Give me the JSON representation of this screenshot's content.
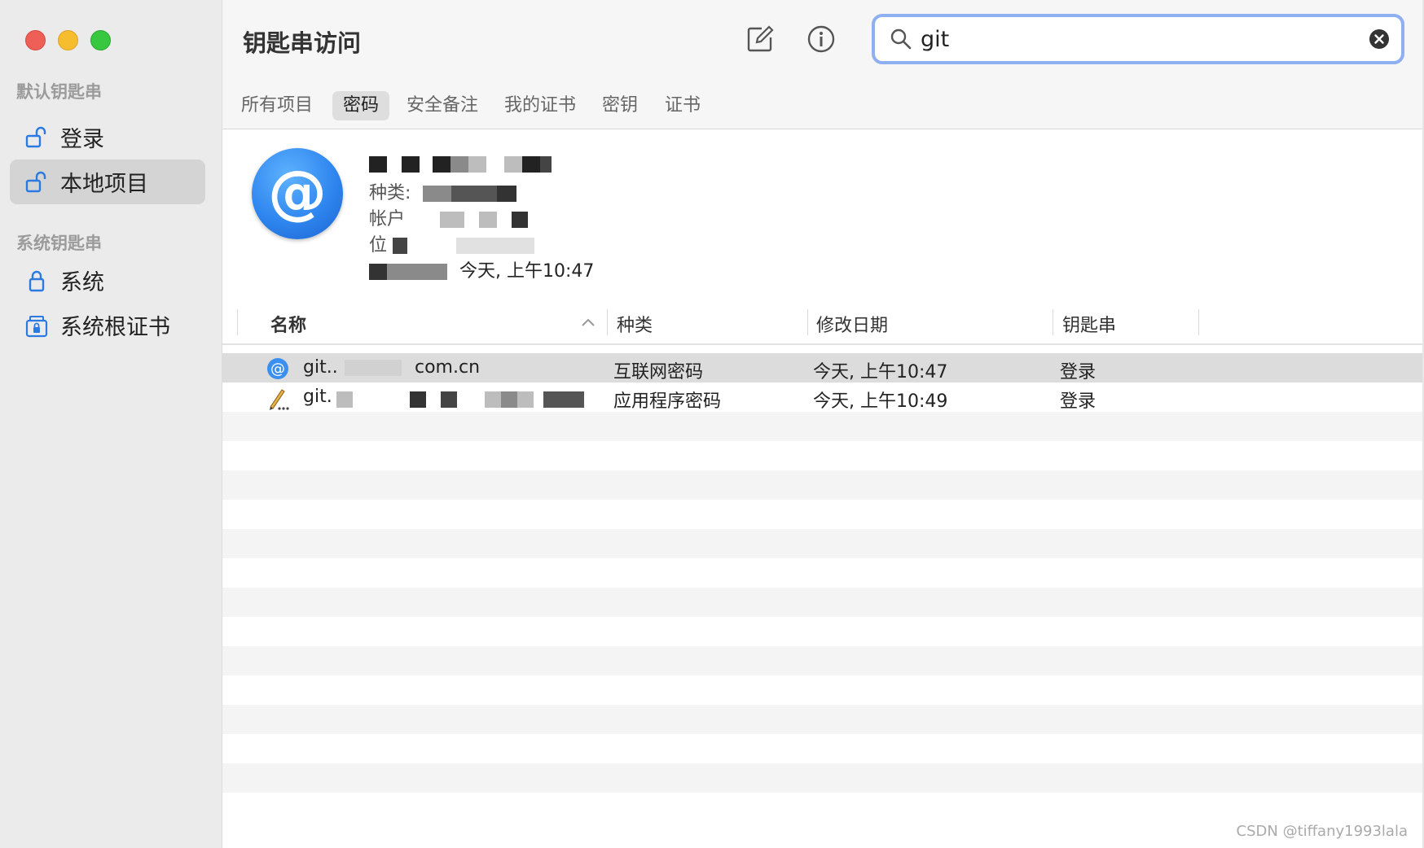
{
  "app": {
    "title": "钥匙串访问"
  },
  "sidebar": {
    "sections": [
      {
        "label": "默认钥匙串",
        "items": [
          {
            "label": "登录",
            "icon": "unlocked-padlock-icon"
          },
          {
            "label": "本地项目",
            "icon": "unlocked-padlock-icon",
            "selected": true
          }
        ]
      },
      {
        "label": "系统钥匙串",
        "items": [
          {
            "label": "系统",
            "icon": "padlock-icon"
          },
          {
            "label": "系统根证书",
            "icon": "cabinet-lock-icon"
          }
        ]
      }
    ]
  },
  "toolbar": {
    "edit_icon": "compose-icon",
    "info_icon": "info-icon"
  },
  "search": {
    "value": "git",
    "icon": "search-icon",
    "clear_icon": "clear-icon"
  },
  "tabs": [
    {
      "label": "所有项目"
    },
    {
      "label": "密码",
      "active": true
    },
    {
      "label": "安全备注"
    },
    {
      "label": "我的证书"
    },
    {
      "label": "密钥"
    },
    {
      "label": "证书"
    }
  ],
  "details": {
    "icon": "at-sign-icon",
    "icon_glyph": "@",
    "kind_label": "种类:",
    "account_label": "帐户",
    "where_label": "位",
    "modified_value": "今天, 上午10:47"
  },
  "table": {
    "headers": {
      "name": "名称",
      "kind": "种类",
      "modified": "修改日期",
      "keychain": "钥匙串"
    },
    "rows": [
      {
        "name_start": "git..",
        "name_end": "com.cn",
        "kind": "互联网密码",
        "modified": "今天, 上午10:47",
        "keychain": "登录",
        "icon": "at-sign-icon",
        "selected": true
      },
      {
        "name_start": "git.",
        "name_end": "",
        "kind": "应用程序密码",
        "modified": "今天, 上午10:49",
        "keychain": "登录",
        "icon": "pencil-key-icon"
      }
    ]
  },
  "watermark": "CSDN @tiffany1993lala",
  "colors": {
    "accent": "#2f86ee",
    "search_focus": "#8fb0f0",
    "selected_row": "#dcdcdc"
  }
}
